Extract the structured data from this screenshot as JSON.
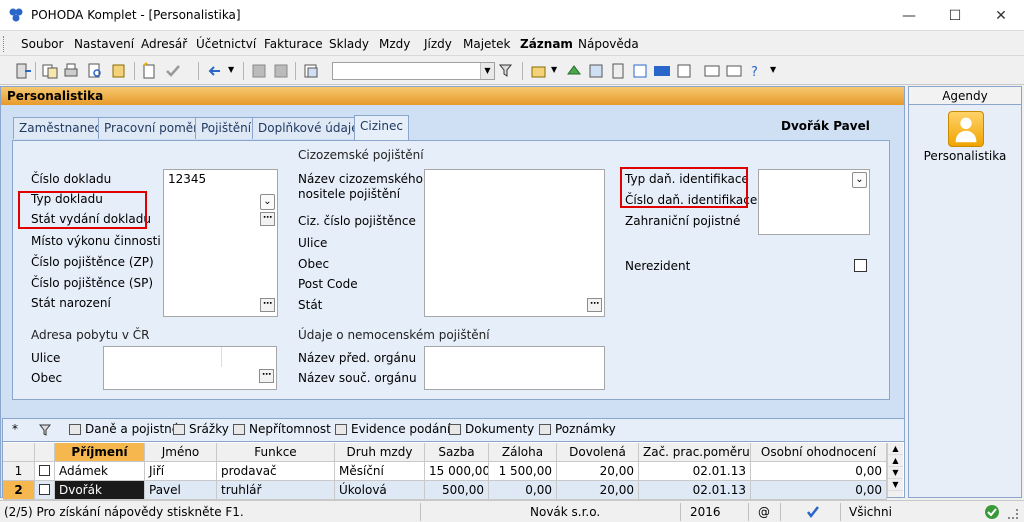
{
  "window": {
    "title": "POHODA Komplet - [Personalistika]"
  },
  "menu": [
    "Soubor",
    "Nastavení",
    "Adresář",
    "Účetnictví",
    "Fakturace",
    "Sklady",
    "Mzdy",
    "Jízdy",
    "Majetek",
    "Záznam",
    "Nápověda"
  ],
  "panel": {
    "title": "Personalistika",
    "employee": "Dvořák Pavel"
  },
  "tabs": [
    "Zaměstnanec",
    "Pracovní poměr",
    "Pojištění",
    "Doplňkové údaje",
    "Cizinec"
  ],
  "form": {
    "col1": {
      "labels": [
        "Číslo dokladu",
        "Typ dokladu",
        "Stát vydání dokladu",
        "Místo výkonu činnosti",
        "Číslo pojištěnce (ZP)",
        "Číslo pojištěnce (SP)",
        "Stát narození"
      ],
      "cislo_dokladu": "12345",
      "address_section": "Adresa pobytu v ČR",
      "address_labels": [
        "Ulice",
        "Obec"
      ]
    },
    "col2": {
      "section": "Cizozemské pojištění",
      "labels": [
        "Název cizozemského",
        "nositele pojištění",
        "Ciz. číslo pojištěnce",
        "Ulice",
        "Obec",
        "Post Code",
        "Stát"
      ],
      "sick_section": "Údaje o nemocenském pojištění",
      "sick_labels": [
        "Název před. orgánu",
        "Název souč. orgánu"
      ]
    },
    "col3": {
      "labels": [
        "Typ daň. identifikace",
        "Číslo daň. identifikace",
        "Zahraniční pojistné"
      ],
      "nerezident": "Nerezident"
    }
  },
  "subtabs": [
    "Daně a pojistné",
    "Srážky",
    "Nepřítomnost",
    "Evidence podání",
    "Dokumenty",
    "Poznámky"
  ],
  "table": {
    "columns": [
      "Příjmení",
      "Jméno",
      "Funkce",
      "Druh mzdy",
      "Sazba",
      "Záloha",
      "Dovolená",
      "Zač. prac.poměru",
      "Osobní ohodnocení"
    ],
    "rows": [
      {
        "n": "1",
        "cells": [
          "Adámek",
          "Jiří",
          "prodavač",
          "Měsíční",
          "15 000,00",
          "1 500,00",
          "20,00",
          "02.01.13",
          "0,00"
        ]
      },
      {
        "n": "2",
        "cells": [
          "Dvořák",
          "Pavel",
          "truhlář",
          "Úkolová",
          "500,00",
          "0,00",
          "20,00",
          "02.01.13",
          "0,00"
        ]
      }
    ]
  },
  "status": {
    "help": "(2/5) Pro získání nápovědy stiskněte F1.",
    "company": "Novák s.r.o.",
    "year": "2016",
    "at": "@",
    "filter": "Všichni"
  },
  "agendy": {
    "title": "Agendy",
    "item": "Personalistika"
  }
}
